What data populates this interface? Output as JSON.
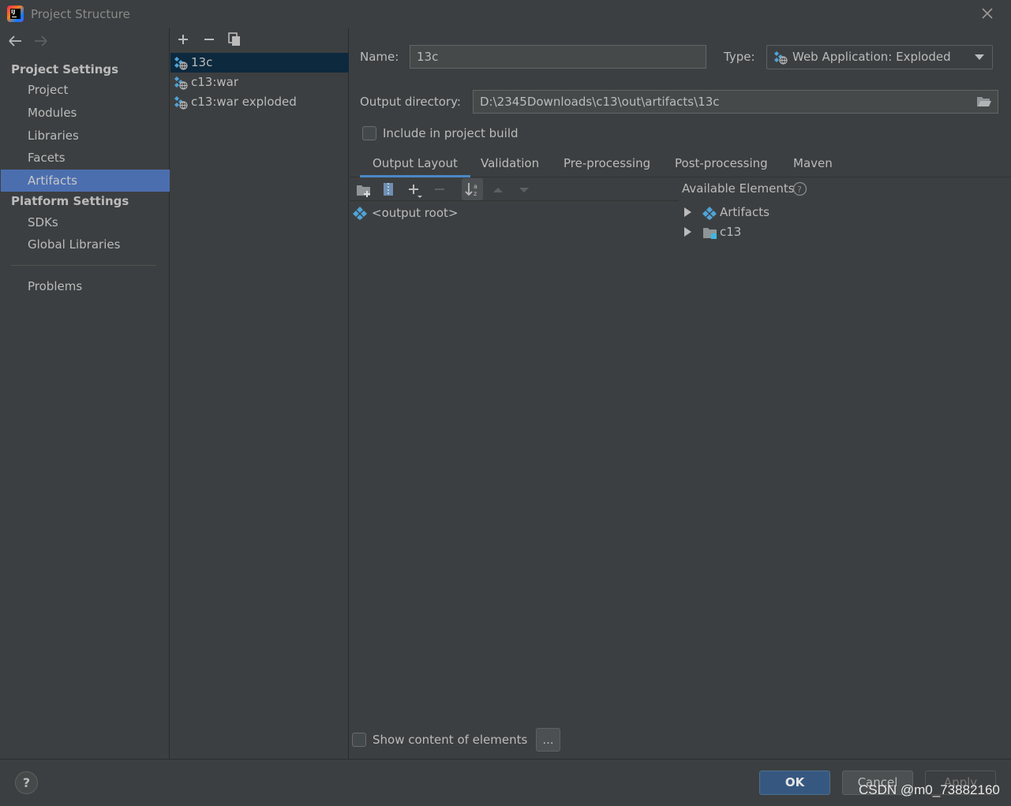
{
  "window": {
    "title": "Project Structure"
  },
  "nav": {
    "project_settings_header": "Project Settings",
    "project_items": [
      "Project",
      "Modules",
      "Libraries",
      "Facets",
      "Artifacts"
    ],
    "platform_settings_header": "Platform Settings",
    "platform_items": [
      "SDKs",
      "Global Libraries"
    ],
    "problems": "Problems",
    "selected": "Artifacts"
  },
  "artifacts": {
    "items": [
      "13c",
      "c13:war",
      "c13:war exploded"
    ],
    "selected": "13c"
  },
  "detail": {
    "name_label": "Name:",
    "name_value": "13c",
    "type_label": "Type:",
    "type_value": "Web Application: Exploded",
    "output_label": "Output directory:",
    "output_value": "D:\\2345Downloads\\c13\\out\\artifacts\\13c",
    "include_build_label": "Include in project build",
    "include_build_checked": false,
    "tabs": [
      "Output Layout",
      "Validation",
      "Pre-processing",
      "Post-processing",
      "Maven"
    ],
    "active_tab": "Output Layout",
    "output_root": "<output root>",
    "available_header": "Available Elements",
    "available_items": [
      "Artifacts",
      "c13"
    ],
    "show_content_label": "Show content of elements",
    "show_content_checked": false,
    "more_button": "..."
  },
  "footer": {
    "help": "?",
    "ok": "OK",
    "cancel": "Cancel",
    "apply": "Apply"
  },
  "watermark": "CSDN @m0_73882160",
  "colors": {
    "background": "#3c3f41",
    "nav_selected": "#4b6eaf",
    "list_selected": "#0d293e",
    "accent_blue": "#4a88c7",
    "ok_button": "#365880"
  },
  "icons": {
    "back": "arrow-left-icon",
    "forward": "arrow-right-icon",
    "add": "plus-icon",
    "remove": "minus-icon",
    "copy": "copy-icon",
    "artifact": "web-artifact-icon",
    "folder": "folder-open-icon",
    "close": "close-icon",
    "help": "help-icon"
  }
}
